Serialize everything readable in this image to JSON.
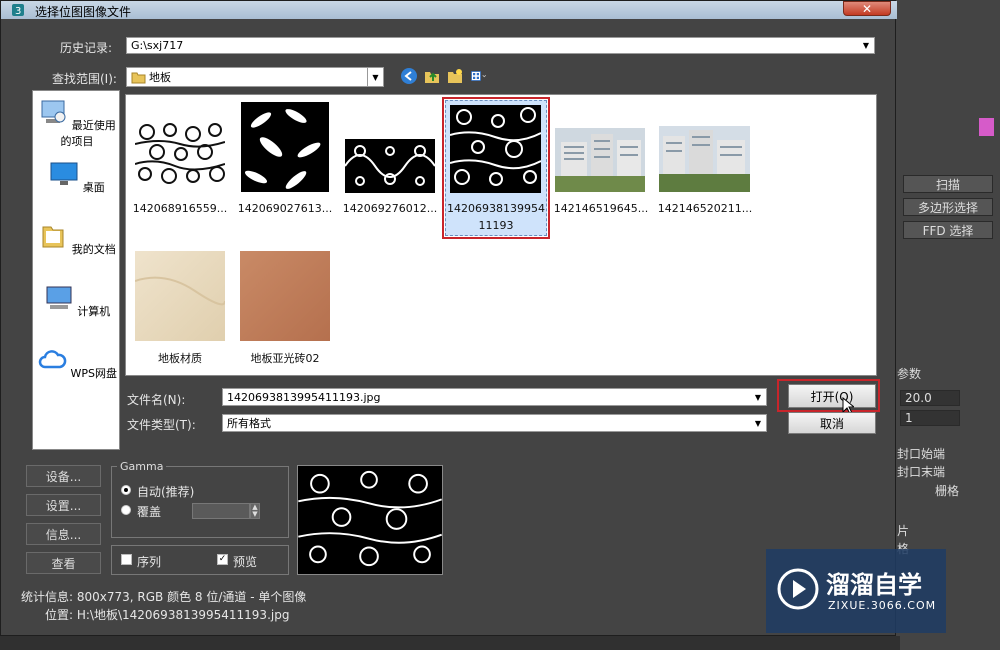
{
  "dialog": {
    "title": "选择位图图像文件",
    "history_label": "历史记录:",
    "history_value": "G:\\sxj717",
    "lookin_label": "查找范围(I):",
    "lookin_value": "地板",
    "places": [
      "最近使用的项目",
      "桌面",
      "我的文档",
      "计算机",
      "WPS网盘"
    ],
    "files": [
      {
        "name": "142068916559...",
        "kind": "pattern-swirl-white"
      },
      {
        "name": "142069027613...",
        "kind": "pattern-leaf-black"
      },
      {
        "name": "142069276012...",
        "kind": "pattern-damask-black"
      },
      {
        "name": "14206938139954",
        "name2": "11193",
        "kind": "pattern-floral-black",
        "selected": true
      },
      {
        "name": "142146519645...",
        "kind": "photo-building"
      },
      {
        "name": "142146520211...",
        "kind": "photo-building2"
      },
      {
        "name": "地板材质",
        "kind": "marble-beige"
      },
      {
        "name": "地板亚光砖02",
        "kind": "tile-terracotta"
      }
    ],
    "filename_label": "文件名(N):",
    "filename_value": "1420693813995411193.jpg",
    "filetype_label": "文件类型(T):",
    "filetype_value": "所有格式",
    "open_label": "打开(O)",
    "cancel_label": "取消",
    "left_buttons": [
      "设备...",
      "设置...",
      "信息...",
      "查看"
    ],
    "gamma": {
      "title": "Gamma",
      "auto_label": "自动(推荐)",
      "override_label": "覆盖"
    },
    "sequence_label": "序列",
    "preview_label": "预览",
    "stats": "统计信息: 800x773, RGB 颜色 8 位/通道 - 单个图像",
    "location": "位置: H:\\地板\\1420693813995411193.jpg"
  },
  "background_panel": {
    "scan": "扫描",
    "poly_select": "多边形选择",
    "ffd_select": "FFD 选择",
    "params": "参数",
    "value1": "20.0",
    "value2": "1",
    "cap_start": "封口始端",
    "cap_end": "封口末端",
    "grid": "栅格",
    "piece": "片",
    "partial_grid": "格"
  },
  "watermark": {
    "brand": "溜溜自学",
    "url": "ZIXUE.3066.COM"
  },
  "colors": {
    "accent_red": "#c8252b",
    "titlebar": "#b9cbdd",
    "dialog_bg": "#444444",
    "selection": "#cfe3fb"
  }
}
